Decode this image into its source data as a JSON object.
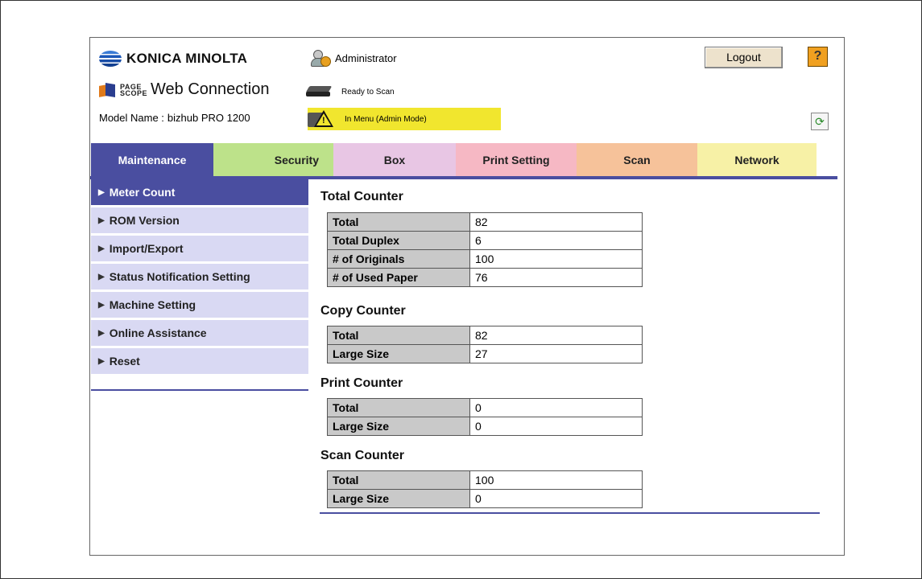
{
  "brand": {
    "company": "KONICA MINOLTA",
    "pagescope_badge": "PAGE SCOPE",
    "product": "Web Connection"
  },
  "model": {
    "label": "Model Name :",
    "value": "bizhub PRO 1200"
  },
  "user": {
    "role": "Administrator"
  },
  "status": {
    "scanner": "Ready to Scan",
    "admin": "In Menu (Admin Mode)"
  },
  "header": {
    "logout_label": "Logout",
    "help_label": "?",
    "refresh_label": "⟳"
  },
  "tabs": [
    {
      "label": "Maintenance"
    },
    {
      "label": "Security"
    },
    {
      "label": "Box"
    },
    {
      "label": "Print Setting"
    },
    {
      "label": "Scan"
    },
    {
      "label": "Network"
    }
  ],
  "sidebar": {
    "items": [
      {
        "label": "Meter Count"
      },
      {
        "label": "ROM Version"
      },
      {
        "label": "Import/Export"
      },
      {
        "label": "Status Notification Setting"
      },
      {
        "label": "Machine Setting"
      },
      {
        "label": "Online Assistance"
      },
      {
        "label": "Reset"
      }
    ]
  },
  "counters": {
    "total": {
      "title": "Total Counter",
      "rows": [
        {
          "label": "Total",
          "value": "82"
        },
        {
          "label": "Total Duplex",
          "value": "6"
        },
        {
          "label": "# of Originals",
          "value": "100"
        },
        {
          "label": "# of Used Paper",
          "value": "76"
        }
      ]
    },
    "copy": {
      "title": "Copy Counter",
      "rows": [
        {
          "label": "Total",
          "value": "82"
        },
        {
          "label": "Large Size",
          "value": "27"
        }
      ]
    },
    "print": {
      "title": "Print Counter",
      "rows": [
        {
          "label": "Total",
          "value": "0"
        },
        {
          "label": "Large Size",
          "value": "0"
        }
      ]
    },
    "scan": {
      "title": "Scan Counter",
      "rows": [
        {
          "label": "Total",
          "value": "100"
        },
        {
          "label": "Large Size",
          "value": "0"
        }
      ]
    }
  },
  "colors": {
    "accent": "#4a4ea0",
    "sidebar_bg": "#d9d9f3",
    "warning_bg": "#f1e62e",
    "table_label_bg": "#c9c9c9"
  }
}
